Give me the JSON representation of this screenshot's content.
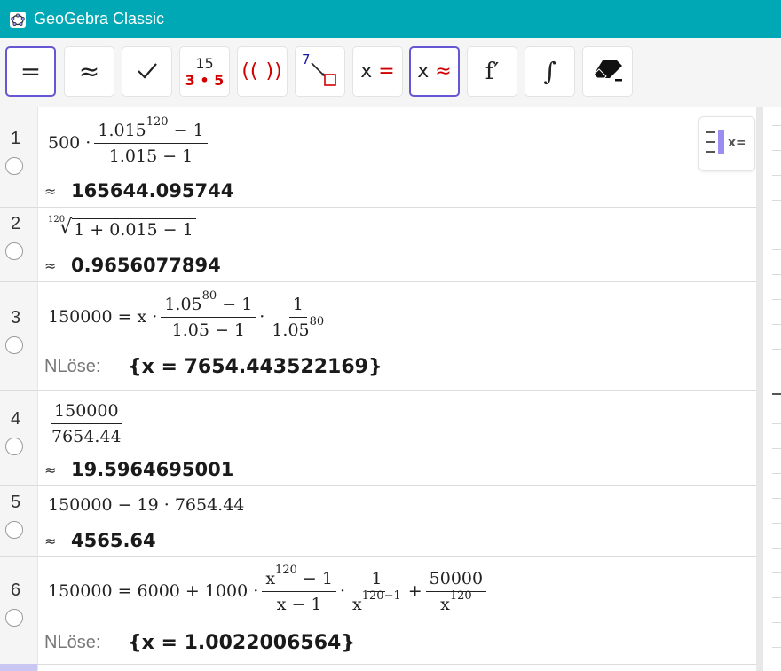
{
  "window": {
    "title": "GeoGebra Classic"
  },
  "toolbar": {
    "buttons": [
      {
        "name": "evaluate",
        "label": "="
      },
      {
        "name": "numeric",
        "label": "≈"
      },
      {
        "name": "keep-input",
        "label": "✓"
      },
      {
        "name": "factor-top",
        "label": "15"
      },
      {
        "name": "factor-bottom",
        "label": "3 • 5"
      },
      {
        "name": "expand",
        "label": "(( ))"
      },
      {
        "name": "substitute",
        "label": "7"
      },
      {
        "name": "solve",
        "label": "x ="
      },
      {
        "name": "solve-numerically",
        "label": "x ≈"
      },
      {
        "name": "derivative",
        "label": "f′"
      },
      {
        "name": "integral",
        "label": "∫"
      },
      {
        "name": "delete",
        "label": ""
      }
    ]
  },
  "rows": [
    {
      "number": "1",
      "lead": "500 ·",
      "num_base": "1.015",
      "num_exp": "120",
      "num_tail": "− 1",
      "den": "1.015 − 1",
      "result_prefix": "≈",
      "result": "165644.095744"
    },
    {
      "number": "2",
      "root_index": "120",
      "radicand": "1 + 0.015 − 1",
      "result_prefix": "≈",
      "result": "0.9656077894"
    },
    {
      "number": "3",
      "lead": "150000 = x ·",
      "num_base": "1.05",
      "num_exp": "80",
      "num_tail": "− 1",
      "den": "1.05 − 1",
      "mid": "·",
      "frac2_num": "1",
      "frac2_den_base": "1.05",
      "frac2_den_exp": "80",
      "result_prefix": "NLöse:",
      "result": "{x = 7654.443522169}"
    },
    {
      "number": "4",
      "num": "150000",
      "den": "7654.44",
      "result_prefix": "≈",
      "result": "19.5964695001"
    },
    {
      "number": "5",
      "expr": "150000 − 19 · 7654.44",
      "result_prefix": "≈",
      "result": "4565.64"
    },
    {
      "number": "6",
      "lead": "150000 = 6000 + 1000 ·",
      "f1_num_base": "x",
      "f1_num_exp": "120",
      "f1_num_tail": "− 1",
      "f1_den": "x − 1",
      "mid": "·",
      "f2_num": "1",
      "f2_den_base": "x",
      "f2_den_exp": "120−1",
      "plus": "+",
      "f3_num": "50000",
      "f3_den_base": "x",
      "f3_den_exp": "120",
      "result_prefix": "NLöse:",
      "result": "{x = 1.0022006564}"
    }
  ],
  "style_bar": {
    "icon": "algebra-style-icon",
    "label": "x="
  }
}
